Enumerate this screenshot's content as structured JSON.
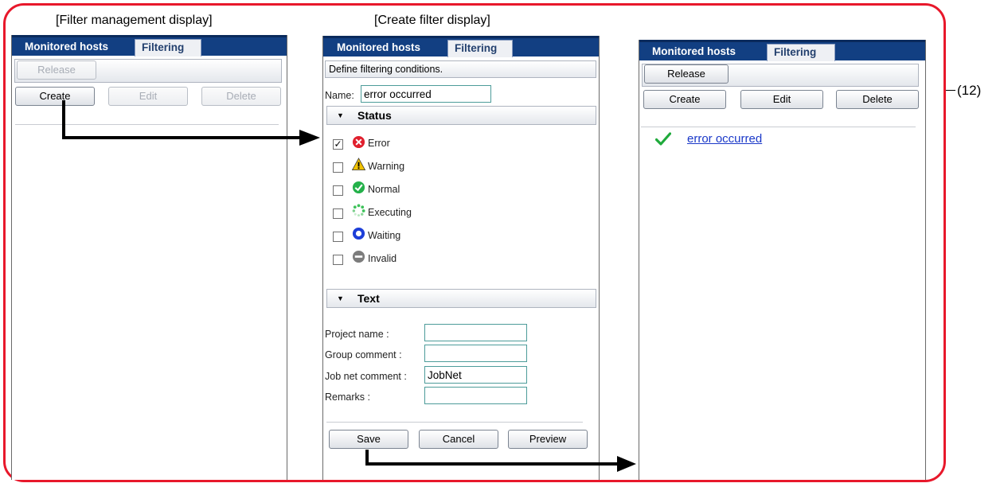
{
  "captions": {
    "filter_management": "[Filter management display]",
    "create_filter": "[Create filter display]",
    "callout": "(12)"
  },
  "tabs": {
    "monitored_hosts": "Monitored hosts",
    "filtering": "Filtering"
  },
  "buttons": {
    "release": "Release",
    "create": "Create",
    "edit": "Edit",
    "delete": "Delete",
    "save": "Save",
    "cancel": "Cancel",
    "preview": "Preview"
  },
  "create_filter": {
    "description": "Define filtering conditions.",
    "name_label": "Name:",
    "name_value": "error occurred",
    "status_section": "Status",
    "statuses": [
      {
        "label": "Error",
        "checked": true,
        "icon": "error-icon",
        "color": "#e0202e"
      },
      {
        "label": "Warning",
        "checked": false,
        "icon": "warning-icon",
        "color": "#f2c300"
      },
      {
        "label": "Normal",
        "checked": false,
        "icon": "normal-icon",
        "color": "#24b14a"
      },
      {
        "label": "Executing",
        "checked": false,
        "icon": "executing-icon",
        "color": "#3ec25a"
      },
      {
        "label": "Waiting",
        "checked": false,
        "icon": "waiting-icon",
        "color": "#1d3fd8"
      },
      {
        "label": "Invalid",
        "checked": false,
        "icon": "invalid-icon",
        "color": "#7c7c7c"
      }
    ],
    "text_section": "Text",
    "fields": [
      {
        "label": "Project name :",
        "value": ""
      },
      {
        "label": "Group comment :",
        "value": ""
      },
      {
        "label": "Job net comment :",
        "value": "JobNet"
      },
      {
        "label": "Remarks :",
        "value": ""
      }
    ]
  },
  "result": {
    "filter_name": "error occurred",
    "icon": "checkmark-icon"
  },
  "colors": {
    "frame": "#e8182b",
    "tabbar": "#123f82",
    "link": "#1a38c8",
    "check": "#1faa3b"
  }
}
